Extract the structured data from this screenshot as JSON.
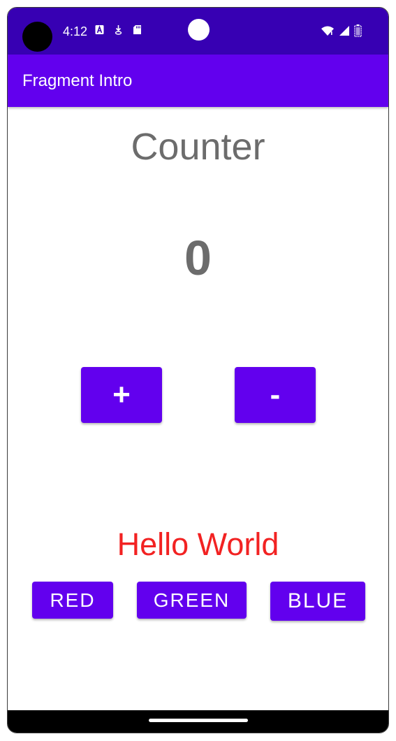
{
  "status_bar": {
    "time": "4:12",
    "icons_left": [
      "a-notification-icon",
      "download-icon",
      "sd-card-icon"
    ],
    "icons_right": [
      "wifi-icon",
      "signal-icon",
      "battery-icon"
    ],
    "bg_color": "#3700b3"
  },
  "app_bar": {
    "title": "Fragment Intro",
    "bg_color": "#6200ee"
  },
  "counter": {
    "title": "Counter",
    "value": "0",
    "increment_label": "+",
    "decrement_label": "-"
  },
  "greeting": {
    "text": "Hello World",
    "color": "#f22222"
  },
  "color_buttons": {
    "red": "RED",
    "green": "GREEN",
    "blue": "BLUE"
  },
  "accent_color": "#6200ee"
}
